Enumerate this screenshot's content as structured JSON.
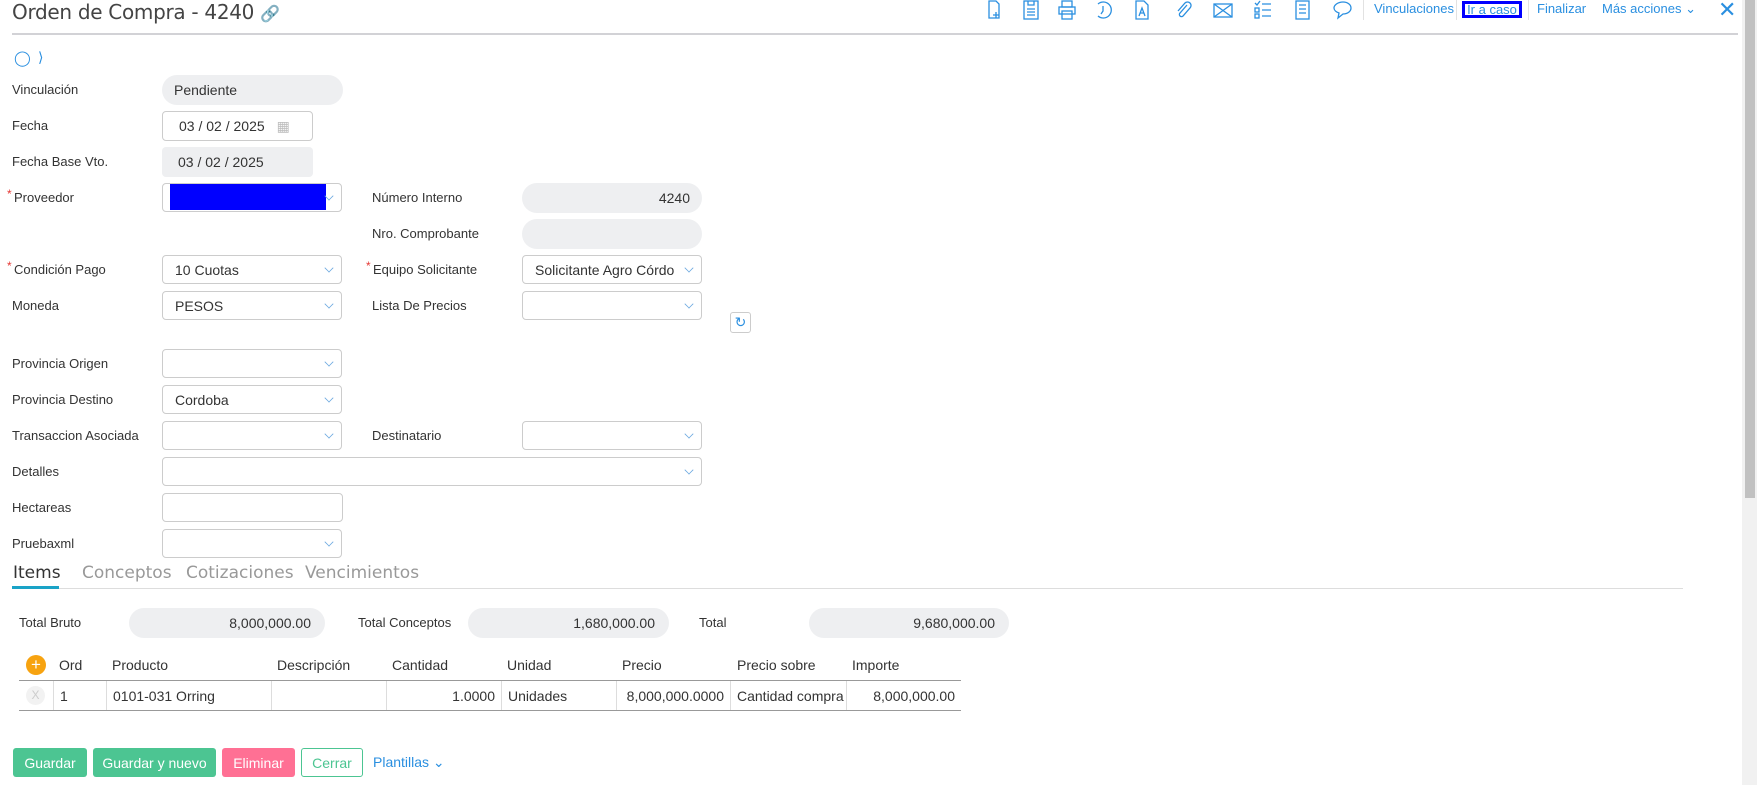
{
  "header": {
    "title": "Orden de Compra - 4240",
    "links": [
      "Vinculaciones",
      "Ir a caso",
      "Finalizar",
      "Más acciones"
    ]
  },
  "toolbar_icons": [
    "new-document-icon",
    "save-icon",
    "print-icon",
    "history-icon",
    "pdf-icon",
    "attach-icon",
    "email-icon",
    "checklist-icon",
    "report-icon",
    "comment-icon"
  ],
  "form": {
    "vinculacion": {
      "label": "Vinculación",
      "value": "Pendiente"
    },
    "fecha": {
      "label": "Fecha",
      "d": "03",
      "m": "02",
      "y": "2025"
    },
    "fecha_base": {
      "label": "Fecha Base Vto.",
      "d": "03",
      "m": "02",
      "y": "2025"
    },
    "proveedor": {
      "label": "Proveedor",
      "value": ""
    },
    "numero_interno": {
      "label": "Número Interno",
      "value": "4240"
    },
    "nro_comprobante": {
      "label": "Nro. Comprobante",
      "value": ""
    },
    "condicion_pago": {
      "label": "Condición Pago",
      "value": "10 Cuotas"
    },
    "equipo": {
      "label": "Equipo Solicitante",
      "value": "Solicitante Agro Córdob"
    },
    "moneda": {
      "label": "Moneda",
      "value": "PESOS"
    },
    "lista_precios": {
      "label": "Lista De Precios",
      "value": ""
    },
    "provincia_origen": {
      "label": "Provincia Origen",
      "value": ""
    },
    "provincia_destino": {
      "label": "Provincia Destino",
      "value": "Cordoba"
    },
    "transaccion": {
      "label": "Transaccion Asociada",
      "value": ""
    },
    "destinatario": {
      "label": "Destinatario",
      "value": ""
    },
    "detalles": {
      "label": "Detalles",
      "value": ""
    },
    "hectareas": {
      "label": "Hectareas",
      "value": ""
    },
    "pruebaxml": {
      "label": "Pruebaxml",
      "value": ""
    }
  },
  "tabs": [
    "Items",
    "Conceptos",
    "Cotizaciones",
    "Vencimientos"
  ],
  "totals": {
    "bruto_label": "Total Bruto",
    "bruto": "8,000,000.00",
    "conceptos_label": "Total Conceptos",
    "conceptos": "1,680,000.00",
    "total_label": "Total",
    "total": "9,680,000.00"
  },
  "table": {
    "headers": [
      "Ord",
      "Producto",
      "Descripción",
      "Cantidad",
      "Unidad",
      "Precio",
      "Precio sobre",
      "Importe"
    ],
    "rows": [
      {
        "delete": "X",
        "cells": [
          "1",
          "0101-031 Orring",
          "",
          "1.0000",
          "Unidades",
          "8,000,000.0000",
          "Cantidad compra",
          "8,000,000.00"
        ]
      }
    ]
  },
  "buttons": {
    "guardar": "Guardar",
    "guardar_nuevo": "Guardar y nuevo",
    "eliminar": "Eliminar",
    "cerrar": "Cerrar",
    "plantillas": "Plantillas"
  },
  "colors": {
    "accent": "#2a8fe0",
    "green": "#4cc592",
    "pink": "#ff7094",
    "highlight": "#0000ff"
  }
}
